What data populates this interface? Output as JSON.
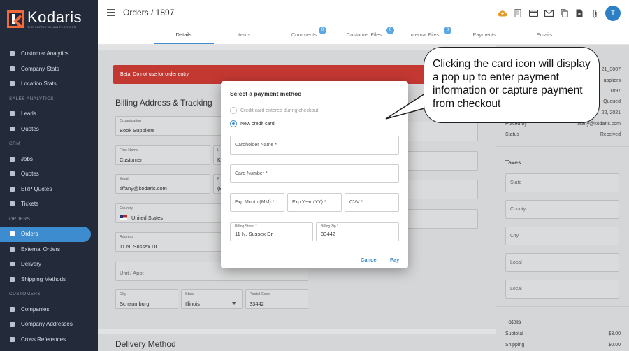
{
  "brand": {
    "name": "Kodaris",
    "tagline": "THE SUPPLY CHAIN PLATFORM"
  },
  "sidebar": {
    "items": [
      {
        "type": "item",
        "label": "Customer Analytics",
        "icon": "chart-icon"
      },
      {
        "type": "item",
        "label": "Company Stats",
        "icon": "chart-icon"
      },
      {
        "type": "item",
        "label": "Location Stats",
        "icon": "chart-icon"
      },
      {
        "type": "section",
        "label": "SALES ANALYTICS"
      },
      {
        "type": "item",
        "label": "Leads",
        "icon": "chart-icon"
      },
      {
        "type": "item",
        "label": "Quotes",
        "icon": "chart-icon"
      },
      {
        "type": "section",
        "label": "CRM"
      },
      {
        "type": "item",
        "label": "Jobs",
        "icon": "pin-icon"
      },
      {
        "type": "item",
        "label": "Quotes",
        "icon": "document-icon"
      },
      {
        "type": "item",
        "label": "ERP Quotes",
        "icon": "document-icon"
      },
      {
        "type": "item",
        "label": "Tickets",
        "icon": "tag-icon"
      },
      {
        "type": "section",
        "label": "ORDERS"
      },
      {
        "type": "item",
        "label": "Orders",
        "icon": "truck-icon",
        "active": true
      },
      {
        "type": "item",
        "label": "External Orders",
        "icon": "arrow-icon"
      },
      {
        "type": "item",
        "label": "Delivery",
        "icon": "truck-icon"
      },
      {
        "type": "item",
        "label": "Shipping Methods",
        "icon": "truck-icon"
      },
      {
        "type": "section",
        "label": "CUSTOMERS"
      },
      {
        "type": "item",
        "label": "Companies",
        "icon": "building-icon"
      },
      {
        "type": "item",
        "label": "Company Addresses",
        "icon": "pin-icon"
      },
      {
        "type": "item",
        "label": "Cross References",
        "icon": "arrows-icon"
      }
    ]
  },
  "header": {
    "title": "Orders / 1897",
    "avatar_initial": "T",
    "toolbar_icons": [
      "cloud-upload-icon",
      "receipt-icon",
      "credit-card-icon",
      "mail-icon",
      "copy-icon",
      "file-icon",
      "attachment-icon"
    ],
    "tabs": [
      {
        "label": "Details",
        "active": true,
        "badge": null
      },
      {
        "label": "Items",
        "badge": null
      },
      {
        "label": "Comments",
        "badge": "0"
      },
      {
        "label": "Customer Files",
        "badge": "0"
      },
      {
        "label": "Internal Files",
        "badge": "0"
      },
      {
        "label": "Payments",
        "badge": null
      },
      {
        "label": "Emails",
        "badge": null
      }
    ]
  },
  "main": {
    "banner": "Beta: Do not use for order entry.",
    "billing_title": "Billing Address & Tracking",
    "organization": {
      "label": "Organization",
      "value": "Book Suppliers"
    },
    "first_name": {
      "label": "First Name",
      "value": "Customer"
    },
    "last_name_initial": {
      "label": "L",
      "value": "K"
    },
    "email": {
      "label": "Email",
      "value": "tiffany@kodaris.com"
    },
    "phone_initial": {
      "label": "P",
      "value": "(8"
    },
    "country": {
      "label": "Country",
      "value": "United States"
    },
    "address": {
      "label": "Address",
      "value": "11 N. Sussex Dr."
    },
    "unit": {
      "placeholder": "Unit / Appt"
    },
    "city": {
      "label": "City",
      "value": "Schaumburg"
    },
    "state": {
      "label": "State",
      "value": "Illinois"
    },
    "postal": {
      "label": "Postal Code",
      "value": "33442"
    },
    "delivery_title": "Delivery Method"
  },
  "right": {
    "info": [
      {
        "label": "",
        "value": "21_3007"
      },
      {
        "label": "",
        "value": "uppliers"
      },
      {
        "label": "",
        "value": "1897"
      },
      {
        "label": "",
        "value": "Queued"
      },
      {
        "label": "",
        "value": "22, 2021"
      },
      {
        "label": "Placed by",
        "value": "tiffany@kodaris.com"
      },
      {
        "label": "Status",
        "value": "Received"
      }
    ],
    "taxes_title": "Taxes",
    "tax_fields": [
      "State",
      "County",
      "City",
      "Local",
      "Local"
    ],
    "totals_title": "Totals",
    "totals": [
      {
        "label": "Subtotal",
        "value": "$3.00"
      },
      {
        "label": "Shipping",
        "value": "$0.00"
      }
    ]
  },
  "modal": {
    "title": "Select a payment method",
    "option_checkout": "Credit card entered during checkout",
    "option_new": "New credit card",
    "cardholder": "Cardholder Name *",
    "card_number": "Card Number *",
    "exp_month": "Exp Month (MM) *",
    "exp_year": "Exp Year (YY) *",
    "cvv": "CVV *",
    "billing_street_label": "Billing Street *",
    "billing_street_value": "11 N. Sussex Dr.",
    "billing_zip_label": "Billing Zip *",
    "billing_zip_value": "33442",
    "cancel": "Cancel",
    "pay": "Pay"
  },
  "callout": {
    "text": "Clicking the card icon will display a pop up to enter payment information or capture payment from checkout"
  },
  "colors": {
    "sidebar_bg": "#232b3a",
    "accent": "#3d8cd0",
    "banner_red": "#c43832",
    "brand_orange": "#f06a3b"
  }
}
